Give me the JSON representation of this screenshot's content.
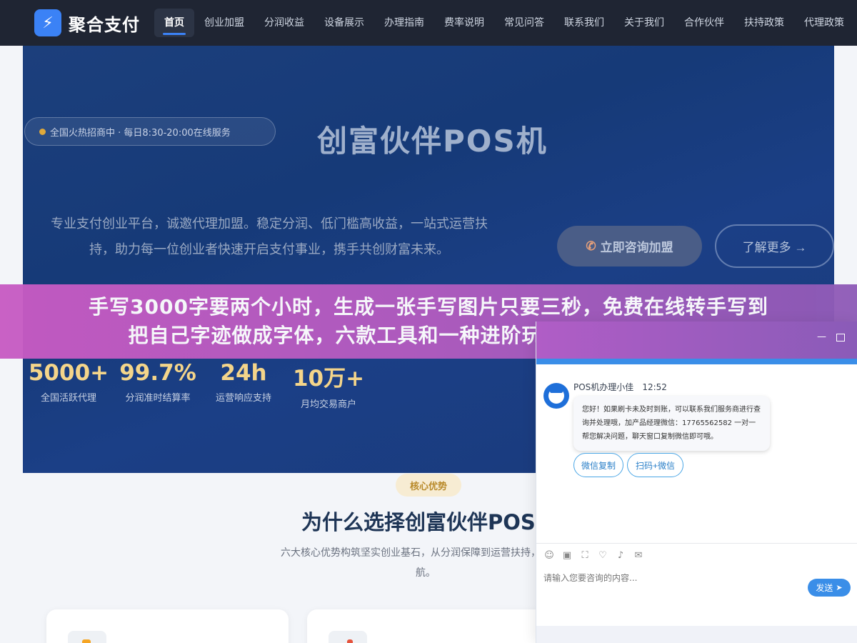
{
  "header": {
    "logo_icon": "lightning-icon",
    "logo_text": "聚合支付",
    "nav": [
      {
        "label": "首页",
        "active": true
      },
      {
        "label": "创业加盟"
      },
      {
        "label": "分润收益"
      },
      {
        "label": "设备展示"
      },
      {
        "label": "办理指南"
      },
      {
        "label": "费率说明"
      },
      {
        "label": "常见问答"
      },
      {
        "label": "联系我们"
      },
      {
        "label": "关于我们"
      },
      {
        "label": "合作伙伴"
      },
      {
        "label": "扶持政策"
      },
      {
        "label": "代理政策"
      }
    ]
  },
  "hero": {
    "pill": "全国火热招商中 · 每日8:30-20:00在线服务",
    "title": "创富伙伴POS机",
    "desc_line1": "专业支付创业平台，诚邀代理加盟。稳定分润、低门槛高收益，一站式运营扶",
    "desc_line2": "持，助力每一位创业者快速开启支付事业，携手共创财富未来。",
    "consult_button": "立即咨询加盟",
    "more_button": "了解更多 →",
    "stats": [
      {
        "value": "5000+",
        "label": "全国活跃代理"
      },
      {
        "value": "99.7%",
        "label": "分润准时结算率"
      },
      {
        "value": "24h",
        "label": "运营响应支持"
      },
      {
        "value": "10万+",
        "label": "月均交易商户"
      }
    ]
  },
  "banner": {
    "line1": "手写3000字要两个小时，生成一张手写图片只要三秒，免费在线转手写到",
    "line2": "把自己字迹做成字体，六款工具和一种进阶玩法让你彻底告别手抄"
  },
  "section": {
    "tag": "核心优势",
    "title": "为什么选择创富伙伴POS",
    "desc_line1": "六大核心优势构筑坚实创业基石，从分润保障到运营扶持，全方位",
    "desc_line2": "航。"
  },
  "chat": {
    "agent_name": "POS机办理小佳",
    "time": "12:52",
    "message": "您好！如果刷卡未及时到账，可以联系我们服务商进行查询并处理哦，加产品经理微信：17765562582 一对一帮您解决问题，聊天窗口复制微信即可哦。",
    "quick_buttons": [
      "微信复制",
      "扫码+微信"
    ],
    "input_placeholder": "请输入您要咨询的内容...",
    "send_label": "发送",
    "minimize_symbol": "—"
  },
  "colors": {
    "header_bg": "#1f2533",
    "accent": "#3b82f6",
    "hero_bg": "#1b3f80",
    "stat_gold": "#f4d58a",
    "banner": "#c85bc3",
    "chat_blue": "#3a8ee8"
  }
}
